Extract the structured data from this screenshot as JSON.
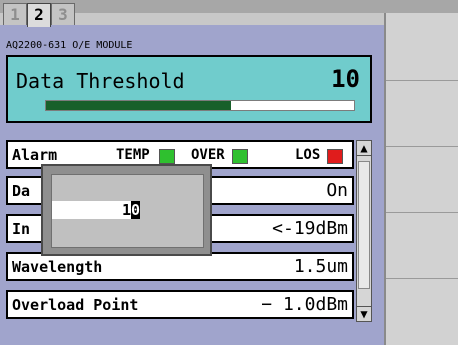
{
  "tabs": [
    {
      "label": "1",
      "active": false
    },
    {
      "label": "2",
      "active": true
    },
    {
      "label": "3",
      "active": false
    }
  ],
  "module_title": "AQ2200-631 O/E MODULE",
  "threshold": {
    "label": "Data Threshold",
    "value": "10",
    "bar_fraction": 0.6
  },
  "alarm": {
    "label": "Alarm",
    "indicators": [
      {
        "label": "TEMP",
        "color": "#2fc02f"
      },
      {
        "label": "OVER",
        "color": "#2fc02f"
      },
      {
        "label": "LOS",
        "color": "#e01c1c"
      }
    ]
  },
  "rows": [
    {
      "label": "Da",
      "value": "On"
    },
    {
      "label": "In",
      "value": "<-19dBm"
    },
    {
      "label": "Wavelength",
      "value": "1.5um"
    },
    {
      "label": "Overload Point",
      "value": "−  1.0dBm"
    }
  ],
  "popup": {
    "digit1": "1",
    "digit2": "0"
  },
  "colors": {
    "accent_box": "#70cccc",
    "panel": "#a0a4cc"
  }
}
